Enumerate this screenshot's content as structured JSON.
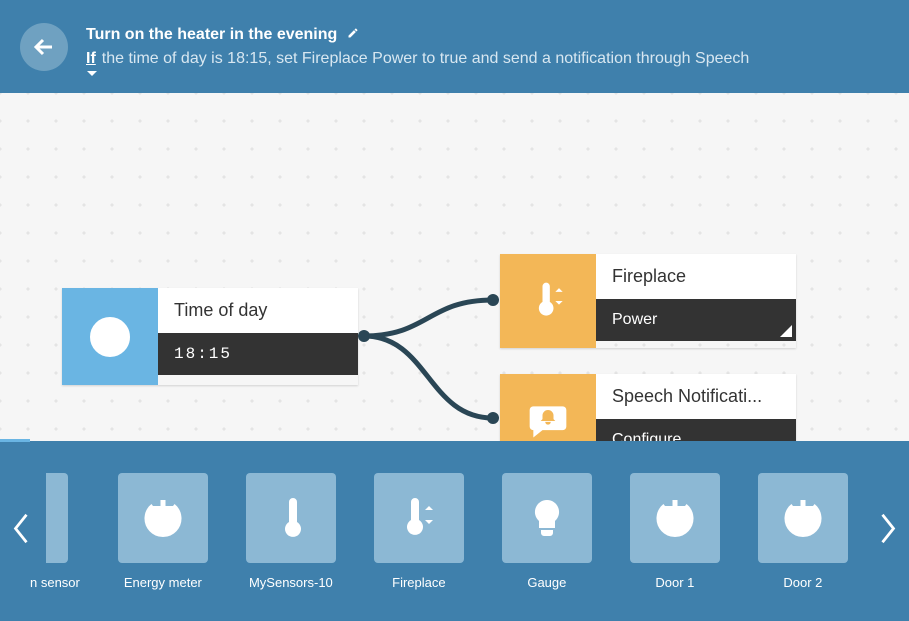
{
  "header": {
    "title": "Turn on the heater in the evening",
    "if_label": "If",
    "description": "the time of day is 18:15, set Fireplace Power to true and send a notification through Speech"
  },
  "trigger": {
    "title": "Time of day",
    "value": "18:15"
  },
  "actions": [
    {
      "title": "Fireplace",
      "value": "Power"
    },
    {
      "title": "Speech Notificati...",
      "value": "Configure..."
    }
  ],
  "palette": {
    "items": [
      {
        "label": "n sensor",
        "icon": "power"
      },
      {
        "label": "Energy meter",
        "icon": "power"
      },
      {
        "label": "MySensors-10",
        "icon": "thermometer"
      },
      {
        "label": "Fireplace",
        "icon": "thermostat"
      },
      {
        "label": "Gauge",
        "icon": "bulb"
      },
      {
        "label": "Door 1",
        "icon": "power"
      },
      {
        "label": "Door 2",
        "icon": "power"
      }
    ]
  }
}
